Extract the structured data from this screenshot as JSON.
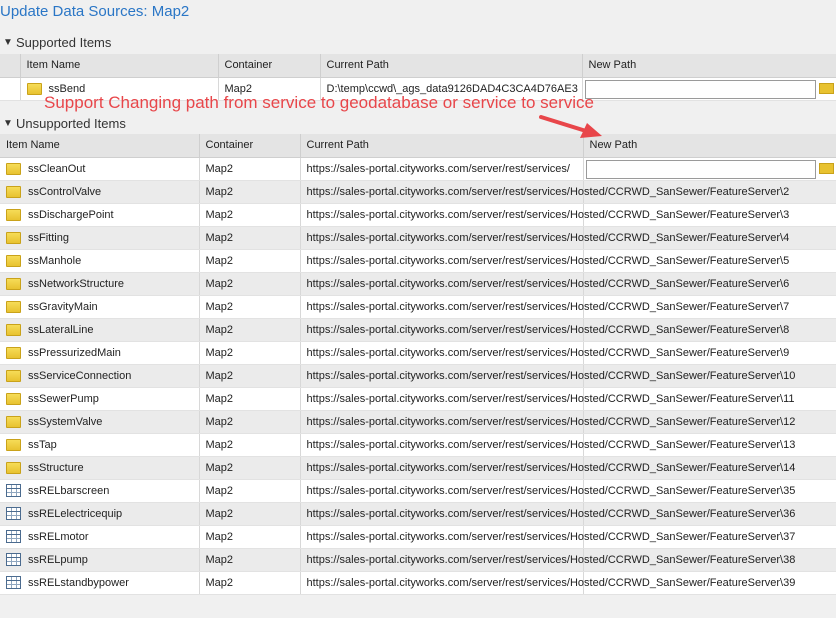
{
  "window": {
    "title": "Update Data Sources: Map2"
  },
  "supported": {
    "header": "Supported Items",
    "columns": [
      "Item Name",
      "Container",
      "Current Path",
      "New Path"
    ],
    "rows": [
      {
        "icon": "feature-class-icon",
        "name": "ssBend",
        "container": "Map2",
        "path": "D:\\temp\\ccwd\\_ags_data9126DAD4C3CA4D76AE3",
        "new_path": ""
      }
    ]
  },
  "annotation": {
    "text": "Support Changing path from service to geodatabase or service to service",
    "color": "#e8464a"
  },
  "unsupported": {
    "header": "Unsupported Items",
    "columns": [
      "Item Name",
      "Container",
      "Current Path",
      "New Path"
    ],
    "rows": [
      {
        "icon": "feature-class-icon",
        "name": "ssCleanOut",
        "container": "Map2",
        "path": "https://sales-portal.cityworks.com/server/rest/services/",
        "editable": true
      },
      {
        "icon": "feature-class-icon",
        "name": "ssControlValve",
        "container": "Map2",
        "path": "https://sales-portal.cityworks.com/server/rest/services/Hosted/CCRWD_SanSewer/FeatureServer\\2"
      },
      {
        "icon": "feature-class-icon",
        "name": "ssDischargePoint",
        "container": "Map2",
        "path": "https://sales-portal.cityworks.com/server/rest/services/Hosted/CCRWD_SanSewer/FeatureServer\\3"
      },
      {
        "icon": "feature-class-icon",
        "name": "ssFitting",
        "container": "Map2",
        "path": "https://sales-portal.cityworks.com/server/rest/services/Hosted/CCRWD_SanSewer/FeatureServer\\4"
      },
      {
        "icon": "feature-class-icon",
        "name": "ssManhole",
        "container": "Map2",
        "path": "https://sales-portal.cityworks.com/server/rest/services/Hosted/CCRWD_SanSewer/FeatureServer\\5"
      },
      {
        "icon": "feature-class-icon",
        "name": "ssNetworkStructure",
        "container": "Map2",
        "path": "https://sales-portal.cityworks.com/server/rest/services/Hosted/CCRWD_SanSewer/FeatureServer\\6"
      },
      {
        "icon": "feature-class-icon",
        "name": "ssGravityMain",
        "container": "Map2",
        "path": "https://sales-portal.cityworks.com/server/rest/services/Hosted/CCRWD_SanSewer/FeatureServer\\7"
      },
      {
        "icon": "feature-class-icon",
        "name": "ssLateralLine",
        "container": "Map2",
        "path": "https://sales-portal.cityworks.com/server/rest/services/Hosted/CCRWD_SanSewer/FeatureServer\\8"
      },
      {
        "icon": "feature-class-icon",
        "name": "ssPressurizedMain",
        "container": "Map2",
        "path": "https://sales-portal.cityworks.com/server/rest/services/Hosted/CCRWD_SanSewer/FeatureServer\\9"
      },
      {
        "icon": "feature-class-icon",
        "name": "ssServiceConnection",
        "container": "Map2",
        "path": "https://sales-portal.cityworks.com/server/rest/services/Hosted/CCRWD_SanSewer/FeatureServer\\10"
      },
      {
        "icon": "feature-class-icon",
        "name": "ssSewerPump",
        "container": "Map2",
        "path": "https://sales-portal.cityworks.com/server/rest/services/Hosted/CCRWD_SanSewer/FeatureServer\\11"
      },
      {
        "icon": "feature-class-icon",
        "name": "ssSystemValve",
        "container": "Map2",
        "path": "https://sales-portal.cityworks.com/server/rest/services/Hosted/CCRWD_SanSewer/FeatureServer\\12"
      },
      {
        "icon": "feature-class-icon",
        "name": "ssTap",
        "container": "Map2",
        "path": "https://sales-portal.cityworks.com/server/rest/services/Hosted/CCRWD_SanSewer/FeatureServer\\13"
      },
      {
        "icon": "feature-class-icon",
        "name": "ssStructure",
        "container": "Map2",
        "path": "https://sales-portal.cityworks.com/server/rest/services/Hosted/CCRWD_SanSewer/FeatureServer\\14"
      },
      {
        "icon": "table-icon",
        "name": "ssRELbarscreen",
        "container": "Map2",
        "path": "https://sales-portal.cityworks.com/server/rest/services/Hosted/CCRWD_SanSewer/FeatureServer\\35"
      },
      {
        "icon": "table-icon",
        "name": "ssRELelectricequip",
        "container": "Map2",
        "path": "https://sales-portal.cityworks.com/server/rest/services/Hosted/CCRWD_SanSewer/FeatureServer\\36"
      },
      {
        "icon": "table-icon",
        "name": "ssRELmotor",
        "container": "Map2",
        "path": "https://sales-portal.cityworks.com/server/rest/services/Hosted/CCRWD_SanSewer/FeatureServer\\37"
      },
      {
        "icon": "table-icon",
        "name": "ssRELpump",
        "container": "Map2",
        "path": "https://sales-portal.cityworks.com/server/rest/services/Hosted/CCRWD_SanSewer/FeatureServer\\38"
      },
      {
        "icon": "table-icon",
        "name": "ssRELstandbypower",
        "container": "Map2",
        "path": "https://sales-portal.cityworks.com/server/rest/services/Hosted/CCRWD_SanSewer/FeatureServer\\39"
      }
    ]
  }
}
